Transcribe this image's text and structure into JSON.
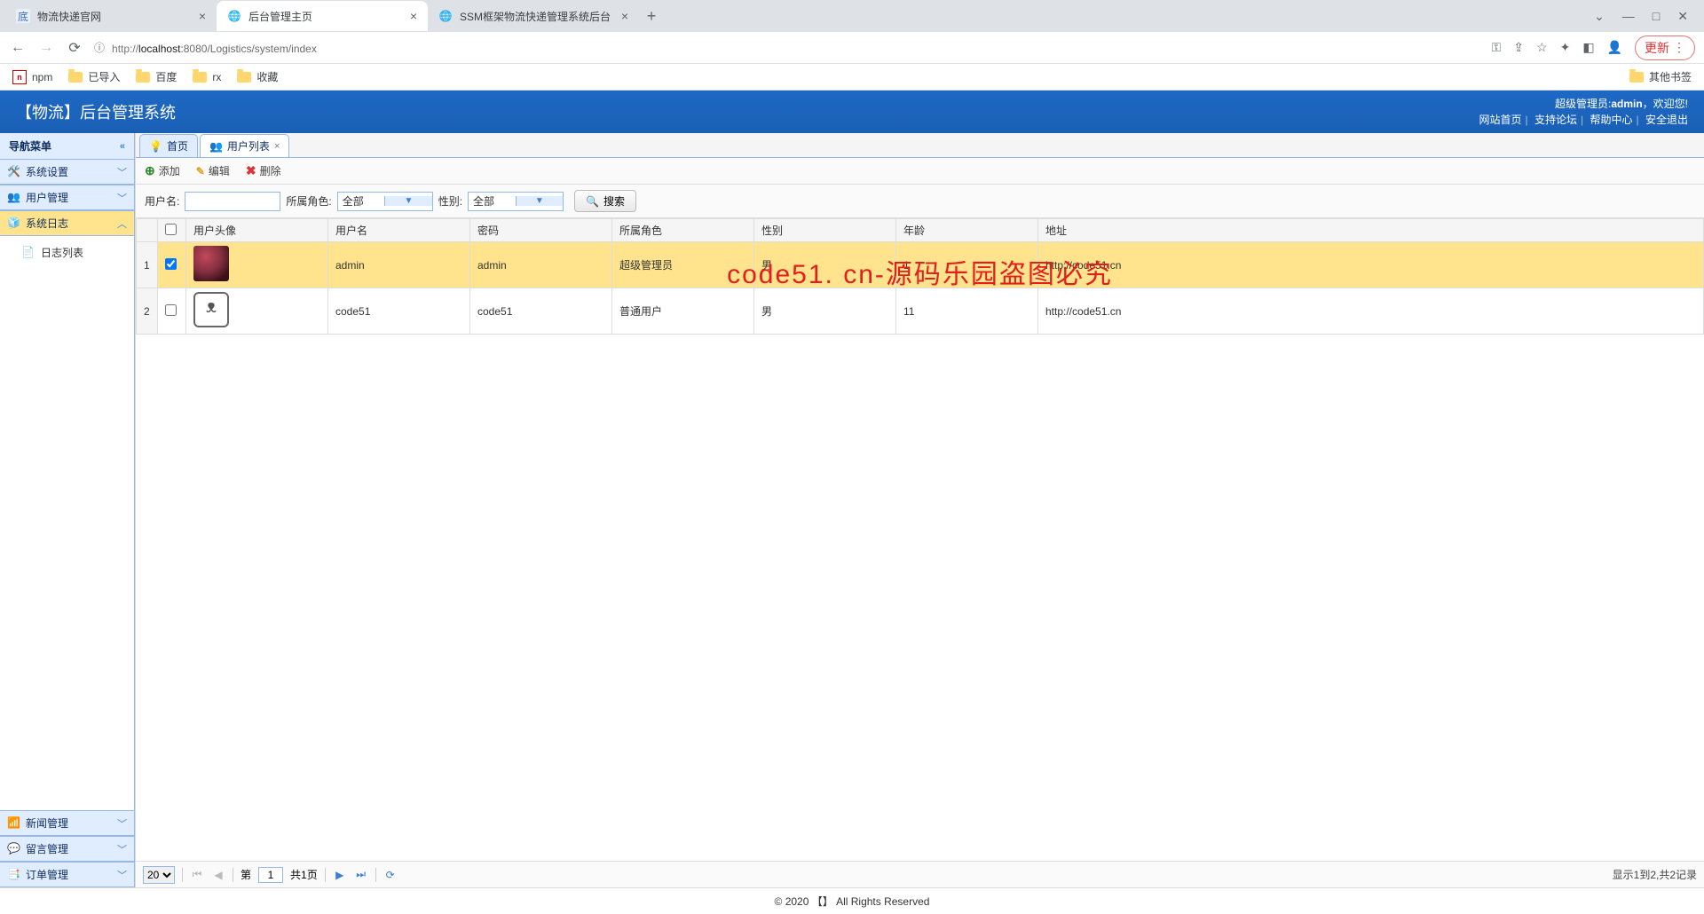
{
  "browser": {
    "tabs": [
      {
        "title": "物流快递官网"
      },
      {
        "title": "后台管理主页"
      },
      {
        "title": "SSM框架物流快递管理系统后台"
      }
    ],
    "active_tab_index": 1,
    "url_host": "localhost",
    "url_port": ":8080",
    "url_path": "/Logistics/system/index",
    "url_prefix": "http://",
    "info_icon_label": "ⓘ",
    "update_label": "更新",
    "bookmarks": [
      {
        "label": "npm",
        "type": "npm"
      },
      {
        "label": "已导入",
        "type": "folder"
      },
      {
        "label": "百度",
        "type": "folder"
      },
      {
        "label": "rx",
        "type": "folder"
      },
      {
        "label": "收藏",
        "type": "folder"
      }
    ],
    "other_bookmarks_label": "其他书签"
  },
  "header": {
    "title": "【物流】后台管理系统",
    "welcome_prefix": "超级管理员:",
    "welcome_user": "admin",
    "welcome_suffix": "，欢迎您!",
    "links": [
      "网站首页",
      "支持论坛",
      "帮助中心",
      "安全退出"
    ]
  },
  "sidebar": {
    "nav_title": "导航菜单",
    "panels": [
      {
        "label": "系统设置",
        "expanded": false
      },
      {
        "label": "用户管理",
        "expanded": false
      },
      {
        "label": "系统日志",
        "expanded": true,
        "selected": true,
        "items": [
          {
            "label": "日志列表"
          }
        ]
      },
      {
        "label": "新闻管理",
        "expanded": false
      },
      {
        "label": "留言管理",
        "expanded": false
      },
      {
        "label": "订单管理",
        "expanded": false
      }
    ]
  },
  "content": {
    "tabs": [
      {
        "label": "首页",
        "closable": false
      },
      {
        "label": "用户列表",
        "closable": true,
        "active": true
      }
    ],
    "toolbar": {
      "add": "添加",
      "edit": "编辑",
      "delete": "删除"
    },
    "filters": {
      "username_label": "用户名:",
      "username_value": "",
      "role_label": "所属角色:",
      "role_value": "全部",
      "gender_label": "性别:",
      "gender_value": "全部",
      "search_label": "搜索"
    },
    "columns": [
      "用户头像",
      "用户名",
      "密码",
      "所属角色",
      "性别",
      "年龄",
      "地址"
    ],
    "rows": [
      {
        "idx": "1",
        "checked": true,
        "avatar": "av1",
        "username": "admin",
        "password": "admin",
        "role": "超级管理员",
        "gender": "男",
        "age": "1",
        "address": "http://code51.cn"
      },
      {
        "idx": "2",
        "checked": false,
        "avatar": "av2",
        "username": "code51",
        "password": "code51",
        "role": "普通用户",
        "gender": "男",
        "age": "11",
        "address": "http://code51.cn"
      }
    ],
    "watermark": "code51. cn-源码乐园盗图必究",
    "pager": {
      "page_size": "20",
      "page_label_prefix": "第",
      "page_value": "1",
      "page_label_suffix": "共1页",
      "info": "显示1到2,共2记录"
    }
  },
  "footer": "© 2020 【】 All Rights Reserved"
}
